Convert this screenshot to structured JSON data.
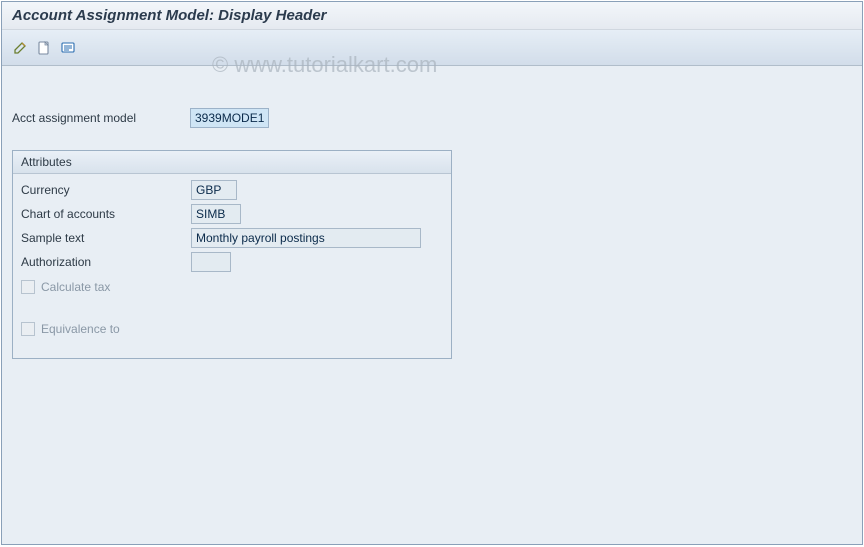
{
  "header": {
    "title": "Account Assignment Model: Display Header"
  },
  "watermark": "© www.tutorialkart.com",
  "top": {
    "model_label": "Acct assignment model",
    "model_value": "3939MODE1"
  },
  "panel": {
    "title": "Attributes",
    "fields": {
      "currency_label": "Currency",
      "currency_value": "GBP",
      "coa_label": "Chart of accounts",
      "coa_value": "SIMB",
      "sample_label": "Sample text",
      "sample_value": "Monthly payroll postings",
      "auth_label": "Authorization",
      "auth_value": ""
    },
    "checks": {
      "calc_tax_label": "Calculate tax",
      "equivalence_label": "Equivalence to"
    }
  },
  "icons": {
    "change": "change-icon",
    "create": "create-icon",
    "detail": "detail-icon"
  }
}
